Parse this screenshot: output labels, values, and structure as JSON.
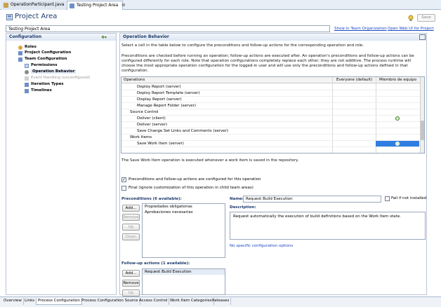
{
  "editor_tabs": [
    {
      "label": "OperationParticipant.java"
    },
    {
      "label": "Testing Project Area",
      "close": "⊠"
    }
  ],
  "header": {
    "title": "Project Area",
    "save_label": "Save"
  },
  "project_name": "Testing Project Area",
  "links": {
    "team_org": "Show in Team Organization",
    "web_ui": "Open Web UI for Project"
  },
  "configuration": {
    "title": "Configuration",
    "items": [
      {
        "label": "Roles"
      },
      {
        "label": "Project Configuration"
      },
      {
        "label": "Team Configuration"
      },
      {
        "label": "Permissions"
      },
      {
        "label": "Operation Behavior"
      },
      {
        "label": "Event Handling (unconfigured)"
      },
      {
        "label": "Iteration Types"
      },
      {
        "label": "Timelines"
      }
    ]
  },
  "operation_behavior": {
    "title": "Operation Behavior",
    "intro1": "Select a cell in the table below to configure the preconditions and follow-up actions for the corresponding operation and role.",
    "intro2": "Preconditions are checked before running an operation; follow-up actions are executed after. An operation's preconditions and follow-up actions can be configured differently for each role. Note that operation configurations completely replace each other; they are not additive. The process runtime will choose the most appropriate operation configuration for the logged-in user and will use only the preconditions and follow-up actions defined in that configuration.",
    "columns": [
      "Operations",
      "Everyone (default)",
      "Miembro de equipo"
    ],
    "rows": [
      {
        "label": "Deploy Report (server)"
      },
      {
        "label": "Deploy Report Template (server)"
      },
      {
        "label": "Display Report (server)"
      },
      {
        "label": "Manage Report Folder (server)"
      },
      {
        "label": "Source Control"
      },
      {
        "label": "Deliver (client)"
      },
      {
        "label": "Deliver (server)"
      },
      {
        "label": "Save Change Set Links and Comments (server)"
      },
      {
        "label": "Work Items"
      },
      {
        "label": "Save Work Item (server)"
      }
    ],
    "summary": "The Save Work Item operation is executed whenever a work item is saved in the repository.",
    "check_configured": "Preconditions and follow-up actions are configured for this operation",
    "check_final": "Final (ignore customization of this operation in child team areas)"
  },
  "preconditions": {
    "title": "Preconditions (6 available):",
    "buttons": [
      "Add...",
      "Remove",
      "Up",
      "Down"
    ],
    "items": [
      "Propiedades obligatorias",
      "Aprobaciones necesarias"
    ]
  },
  "followup": {
    "title": "Follow-up actions (1 available):",
    "buttons": [
      "Add...",
      "Remove",
      "Up"
    ],
    "items": [
      "Request Build Execution"
    ]
  },
  "details": {
    "name_label": "Name:",
    "name_value": "Request Build Execution",
    "fail_label": "Fail if not installed",
    "desc_label": "Description:",
    "desc_value": "Request automatically the execution of build definitions based on the Work Item state.",
    "no_config": "No specific configuration options"
  },
  "bottom_tabs": [
    "Overview",
    "Links",
    "Process Configuration",
    "Process Configuration Source",
    "Access Control",
    "Work Item Categories",
    "Releases"
  ],
  "colors": {
    "accent": "#1f3a6b",
    "selection": "#2f7de1",
    "link": "#1a48c2"
  }
}
